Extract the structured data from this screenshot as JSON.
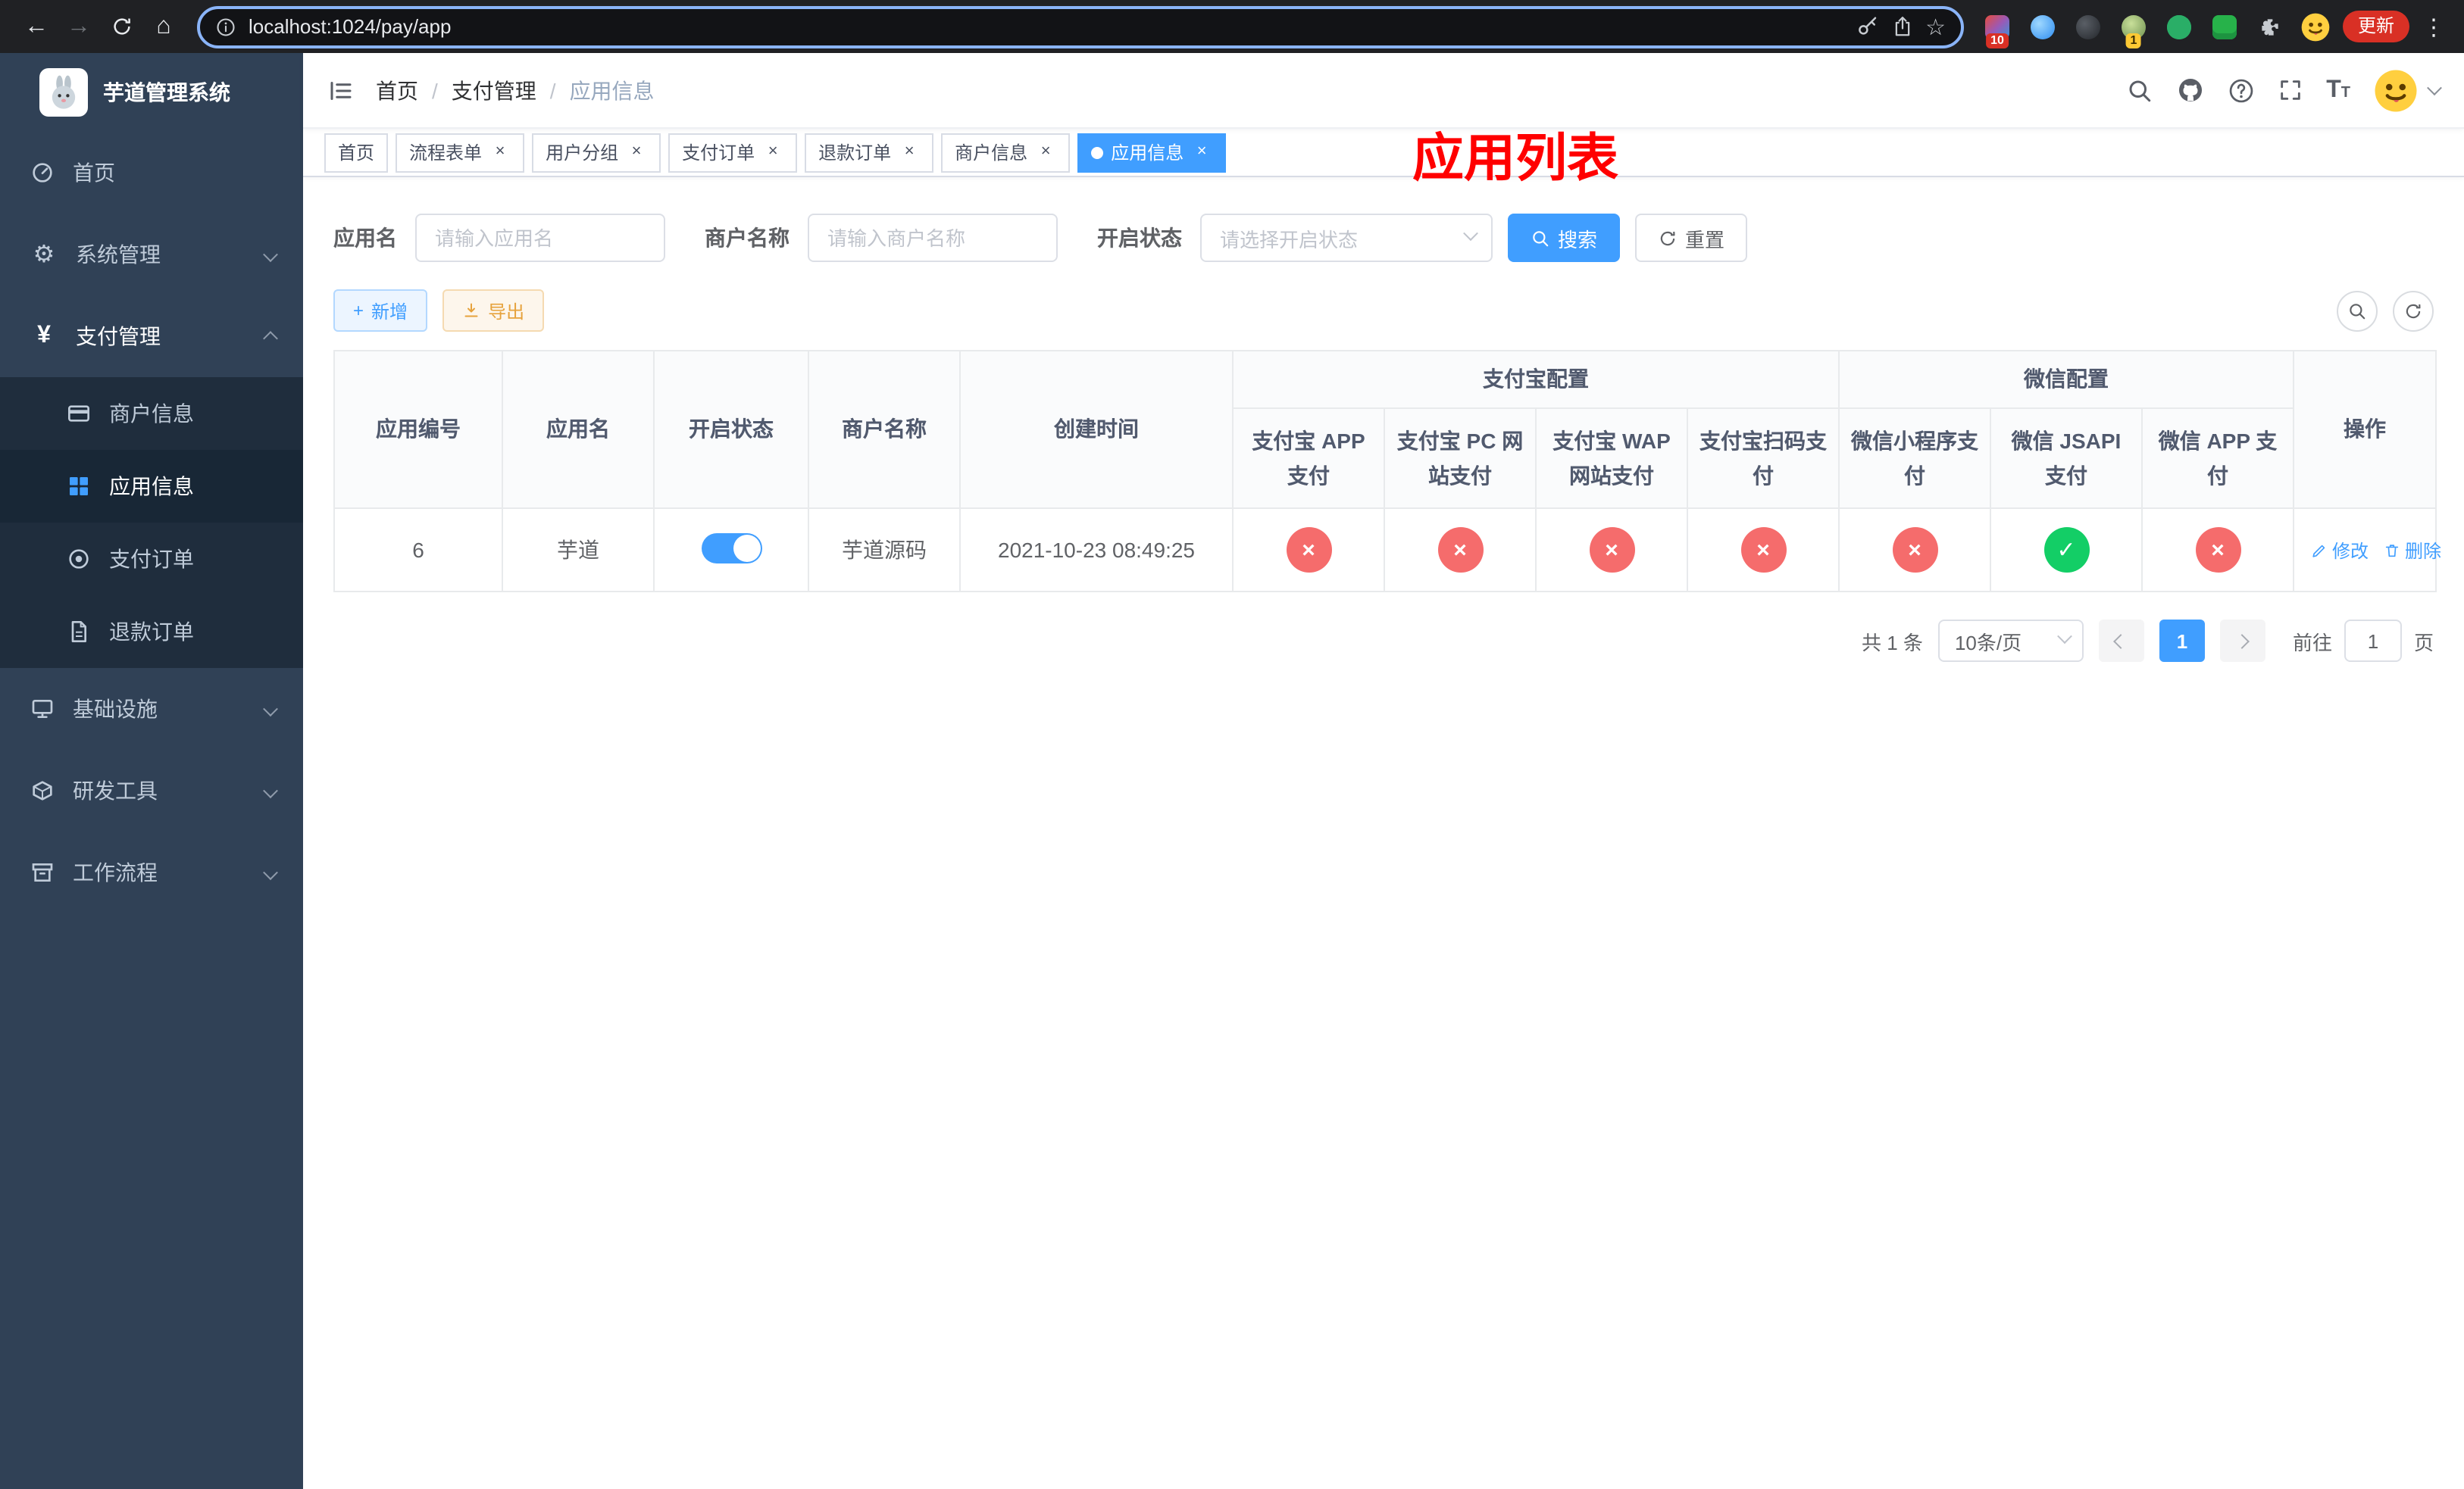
{
  "colors": {
    "accent": "#409EFF",
    "danger": "#F56C6C",
    "success": "#13CE66",
    "annotation": "#FF0000",
    "sidebar_bg": "#304156"
  },
  "icons": {
    "gear": "⚙",
    "yen": "¥",
    "star": "☆",
    "check": "✓",
    "cross": "×",
    "dots": "⋮",
    "back": "←",
    "forward": "→",
    "home": "⌂",
    "font_big": "T",
    "font_small": "T"
  },
  "browser": {
    "url": "localhost:1024/pay/app",
    "update_label": "更新",
    "ext_badge_count": "10",
    "profile_badge_count": "1"
  },
  "sidebar": {
    "title": "芋道管理系统",
    "items": [
      {
        "label": "首页"
      },
      {
        "label": "系统管理"
      },
      {
        "label": "支付管理"
      },
      {
        "label": "基础设施"
      },
      {
        "label": "研发工具"
      },
      {
        "label": "工作流程"
      }
    ],
    "payment_children": [
      {
        "label": "商户信息"
      },
      {
        "label": "应用信息"
      },
      {
        "label": "支付订单"
      },
      {
        "label": "退款订单"
      }
    ]
  },
  "navbar": {
    "breadcrumb": [
      "首页",
      "支付管理",
      "应用信息"
    ],
    "annotation": "应用列表"
  },
  "tabs": [
    {
      "label": "首页"
    },
    {
      "label": "流程表单"
    },
    {
      "label": "用户分组"
    },
    {
      "label": "支付订单"
    },
    {
      "label": "退款订单"
    },
    {
      "label": "商户信息"
    },
    {
      "label": "应用信息"
    }
  ],
  "filters": {
    "app_name_label": "应用名",
    "app_name_placeholder": "请输入应用名",
    "merchant_label": "商户名称",
    "merchant_placeholder": "请输入商户名称",
    "status_label": "开启状态",
    "status_placeholder": "请选择开启状态",
    "search_label": "搜索",
    "reset_label": "重置"
  },
  "toolbar": {
    "add_label": "新增",
    "export_label": "导出"
  },
  "table": {
    "headers": {
      "app_no": "应用编号",
      "app_name": "应用名",
      "status": "开启状态",
      "merchant": "商户名称",
      "create_time": "创建时间",
      "alipay_group": "支付宝配置",
      "wechat_group": "微信配置",
      "actions": "操作",
      "alipay_app": "支付宝 APP 支付",
      "alipay_pc": "支付宝 PC 网站支付",
      "alipay_wap": "支付宝 WAP 网站支付",
      "alipay_scan": "支付宝扫码支付",
      "wx_lite": "微信小程序支付",
      "wx_jsapi": "微信 JSAPI 支付",
      "wx_app": "微信 APP 支付"
    },
    "row": {
      "app_no": "6",
      "app_name": "芋道",
      "status_on": true,
      "merchant": "芋道源码",
      "create_time": "2021-10-23 08:49:25",
      "pay_statuses": [
        false,
        false,
        false,
        false,
        false,
        true,
        false
      ],
      "edit_label": "修改",
      "delete_label": "删除"
    }
  },
  "pagination": {
    "total_text": "共 1 条",
    "page_size": "10条/页",
    "current_page": "1",
    "goto_label": "前往",
    "goto_value": "1",
    "page_unit": "页"
  }
}
